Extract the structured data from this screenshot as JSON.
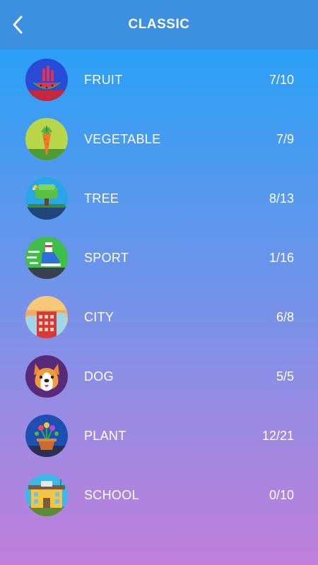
{
  "header": {
    "title": "CLASSIC",
    "back_icon": "chevron-left-icon"
  },
  "categories": [
    {
      "label": "FRUIT",
      "progress": "7/10",
      "icon": "watermelon-icon"
    },
    {
      "label": "VEGETABLE",
      "progress": "7/9",
      "icon": "carrot-icon"
    },
    {
      "label": "TREE",
      "progress": "8/13",
      "icon": "tree-icon"
    },
    {
      "label": "SPORT",
      "progress": "1/16",
      "icon": "sneaker-icon"
    },
    {
      "label": "CITY",
      "progress": "6/8",
      "icon": "building-icon"
    },
    {
      "label": "DOG",
      "progress": "5/5",
      "icon": "dog-icon"
    },
    {
      "label": "PLANT",
      "progress": "12/21",
      "icon": "flower-pot-icon"
    },
    {
      "label": "SCHOOL",
      "progress": "0/10",
      "icon": "school-icon"
    }
  ]
}
